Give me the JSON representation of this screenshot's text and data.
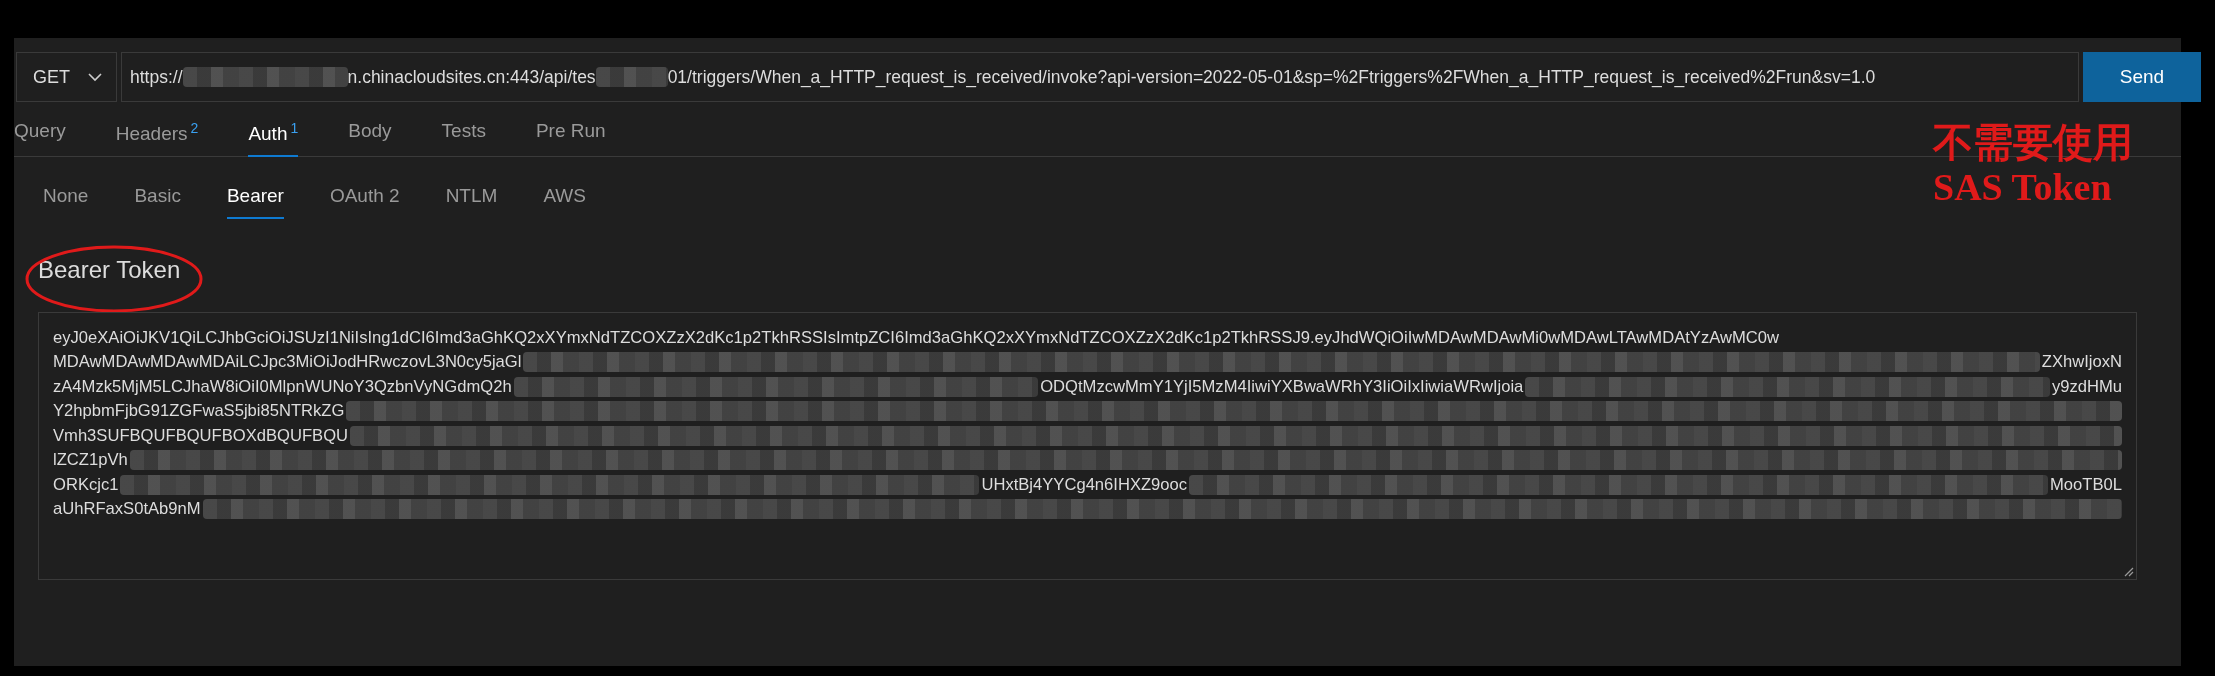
{
  "request": {
    "method": "GET",
    "url": [
      {
        "kind": "text",
        "text": "https://"
      },
      {
        "kind": "redacted"
      },
      {
        "kind": "text",
        "text": "n.chinacloudsites.cn:443/api/tes"
      },
      {
        "kind": "redacted"
      },
      {
        "kind": "text",
        "text": "01/triggers/When_a_HTTP_request_is_received/invoke?api-version=2022-05-01&sp=%2Ftriggers%2FWhen_a_HTTP_request_is_received%2Frun&sv=1.0"
      }
    ],
    "send": "Send"
  },
  "tabs": [
    {
      "label": "Query",
      "selected": false
    },
    {
      "label": "Headers",
      "badge": "2",
      "selected": false
    },
    {
      "label": "Auth",
      "badge": "1",
      "selected": true
    },
    {
      "label": "Body",
      "selected": false
    },
    {
      "label": "Tests",
      "selected": false
    },
    {
      "label": "Pre Run",
      "selected": false
    }
  ],
  "auth_types": [
    {
      "label": "None",
      "selected": false
    },
    {
      "label": "Basic",
      "selected": false
    },
    {
      "label": "Bearer",
      "selected": true
    },
    {
      "label": "OAuth 2",
      "selected": false
    },
    {
      "label": "NTLM",
      "selected": false
    },
    {
      "label": "AWS",
      "selected": false
    }
  ],
  "annotation": {
    "lines": [
      "不需要使用",
      "SAS Token"
    ]
  },
  "bearer": {
    "label": "Bearer Token",
    "token_lines": [
      [
        {
          "kind": "text",
          "text": "eyJ0eXAiOiJKV1QiLCJhbGciOiJSUzI1NiIsIng1dCI6Imd3aGhKQ2xXYmxNdTZCOXZzX2dKc1p2TkhRSSIsImtpZCI6Imd3aGhKQ2xXYmxNdTZCOXZzX2dKc1p2TkhRSSJ9.eyJhdWQiOiIwMDAwMDAwMi0wMDAwLTAwMDAtYzAwMC0w"
        }
      ],
      [
        {
          "kind": "text",
          "text": "MDAwMDAwMDAwMDAiLCJpc3MiOiJodHRwczovL3N0cy5jaGl"
        },
        {
          "kind": "redacted"
        },
        {
          "kind": "text",
          "text": "ZXhwIjoxN"
        }
      ],
      [
        {
          "kind": "text",
          "text": "zA4Mzk5MjM5LCJhaW8iOiI0MlpnWUNoY3QzbnVyNGdmQ2h"
        },
        {
          "kind": "redacted"
        },
        {
          "kind": "text",
          "text": "ODQtMzcwMmY1YjI5MzM4IiwiYXBwaWRhY3IiOiIxIiwiaWRwIjoia"
        },
        {
          "kind": "redacted"
        },
        {
          "kind": "text",
          "text": "y9zdHMu"
        }
      ],
      [
        {
          "kind": "text",
          "text": "Y2hpbmFjbG91ZGFwaS5jbi85NTRkZG"
        },
        {
          "kind": "redacted"
        }
      ],
      [
        {
          "kind": "text",
          "text": "Vmh3SUFBQUFBQUFBOXdBQUFBQU"
        },
        {
          "kind": "redacted"
        }
      ],
      [
        {
          "kind": "text",
          "text": "lZCZ1pVh"
        },
        {
          "kind": "redacted"
        }
      ],
      [
        {
          "kind": "text",
          "text": "ORKcjc1"
        },
        {
          "kind": "redacted"
        },
        {
          "kind": "text",
          "text": "UHxtBj4YYCg4n6IHXZ9ooc"
        },
        {
          "kind": "redacted"
        },
        {
          "kind": "text",
          "text": "MooTB0L"
        }
      ],
      [
        {
          "kind": "text",
          "text": "aUhRFaxS0tAb9nM"
        },
        {
          "kind": "redacted"
        }
      ]
    ]
  }
}
